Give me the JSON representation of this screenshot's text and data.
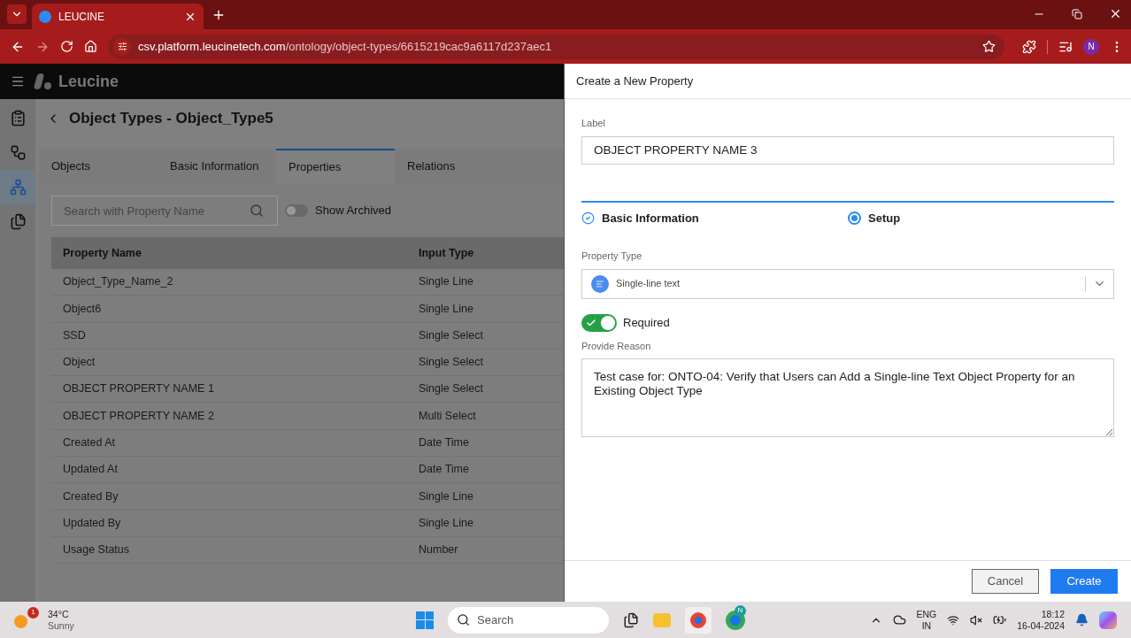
{
  "browser": {
    "tab_title": "LEUCINE",
    "url_host": "csv.platform.leucinetech.com",
    "url_path": "/ontology/object-types/6615219cac9a6117d237aec1",
    "profile_initial": "N"
  },
  "app": {
    "brand": "Leucine",
    "sidebar_items": [
      {
        "selected": false
      },
      {
        "selected": false
      },
      {
        "selected": true
      },
      {
        "selected": false
      }
    ],
    "page_title": "Object Types - Object_Type5",
    "tabs": [
      {
        "label": "Objects",
        "selected": false
      },
      {
        "label": "Basic Information",
        "selected": false
      },
      {
        "label": "Properties",
        "selected": true
      },
      {
        "label": "Relations",
        "selected": false
      }
    ],
    "search": {
      "placeholder": "Search with Property Name"
    },
    "show_archived": {
      "label": "Show Archived",
      "on": false
    },
    "table": {
      "columns": [
        "Property Name",
        "Input Type"
      ],
      "rows": [
        [
          "Object_Type_Name_2",
          "Single Line"
        ],
        [
          "Object6",
          "Single Line"
        ],
        [
          "SSD",
          "Single Select"
        ],
        [
          "Object",
          "Single Select"
        ],
        [
          "OBJECT PROPERTY NAME 1",
          "Single Select"
        ],
        [
          "OBJECT PROPERTY NAME 2",
          "Multi Select"
        ],
        [
          "Created At",
          "Date Time"
        ],
        [
          "Updated At",
          "Date Time"
        ],
        [
          "Created By",
          "Single Line"
        ],
        [
          "Updated By",
          "Single Line"
        ],
        [
          "Usage Status",
          "Number"
        ]
      ]
    }
  },
  "drawer": {
    "title": "Create a New Property",
    "label_field": {
      "label": "Label",
      "value": "OBJECT PROPERTY NAME 3"
    },
    "steps": [
      {
        "label": "Basic Information",
        "done": true
      },
      {
        "label": "Setup",
        "done": false
      }
    ],
    "property_type": {
      "label": "Property Type",
      "value": "Single-line text"
    },
    "required": {
      "label": "Required",
      "on": true
    },
    "reason": {
      "label": "Provide Reason",
      "value": "Test case for: ONTO-04: Verify that Users can Add a Single-line Text Object Property for an Existing Object Type"
    },
    "buttons": [
      {
        "label": "Cancel",
        "kind": "secondary"
      },
      {
        "label": "Create",
        "kind": "primary"
      }
    ]
  },
  "taskbar": {
    "weather_badge": "1",
    "temperature": "34°C",
    "condition": "Sunny",
    "search": "Search",
    "chrome_badge": "N",
    "lang": "ENG",
    "region": "IN",
    "time": "18:12",
    "date": "16-04-2024"
  }
}
